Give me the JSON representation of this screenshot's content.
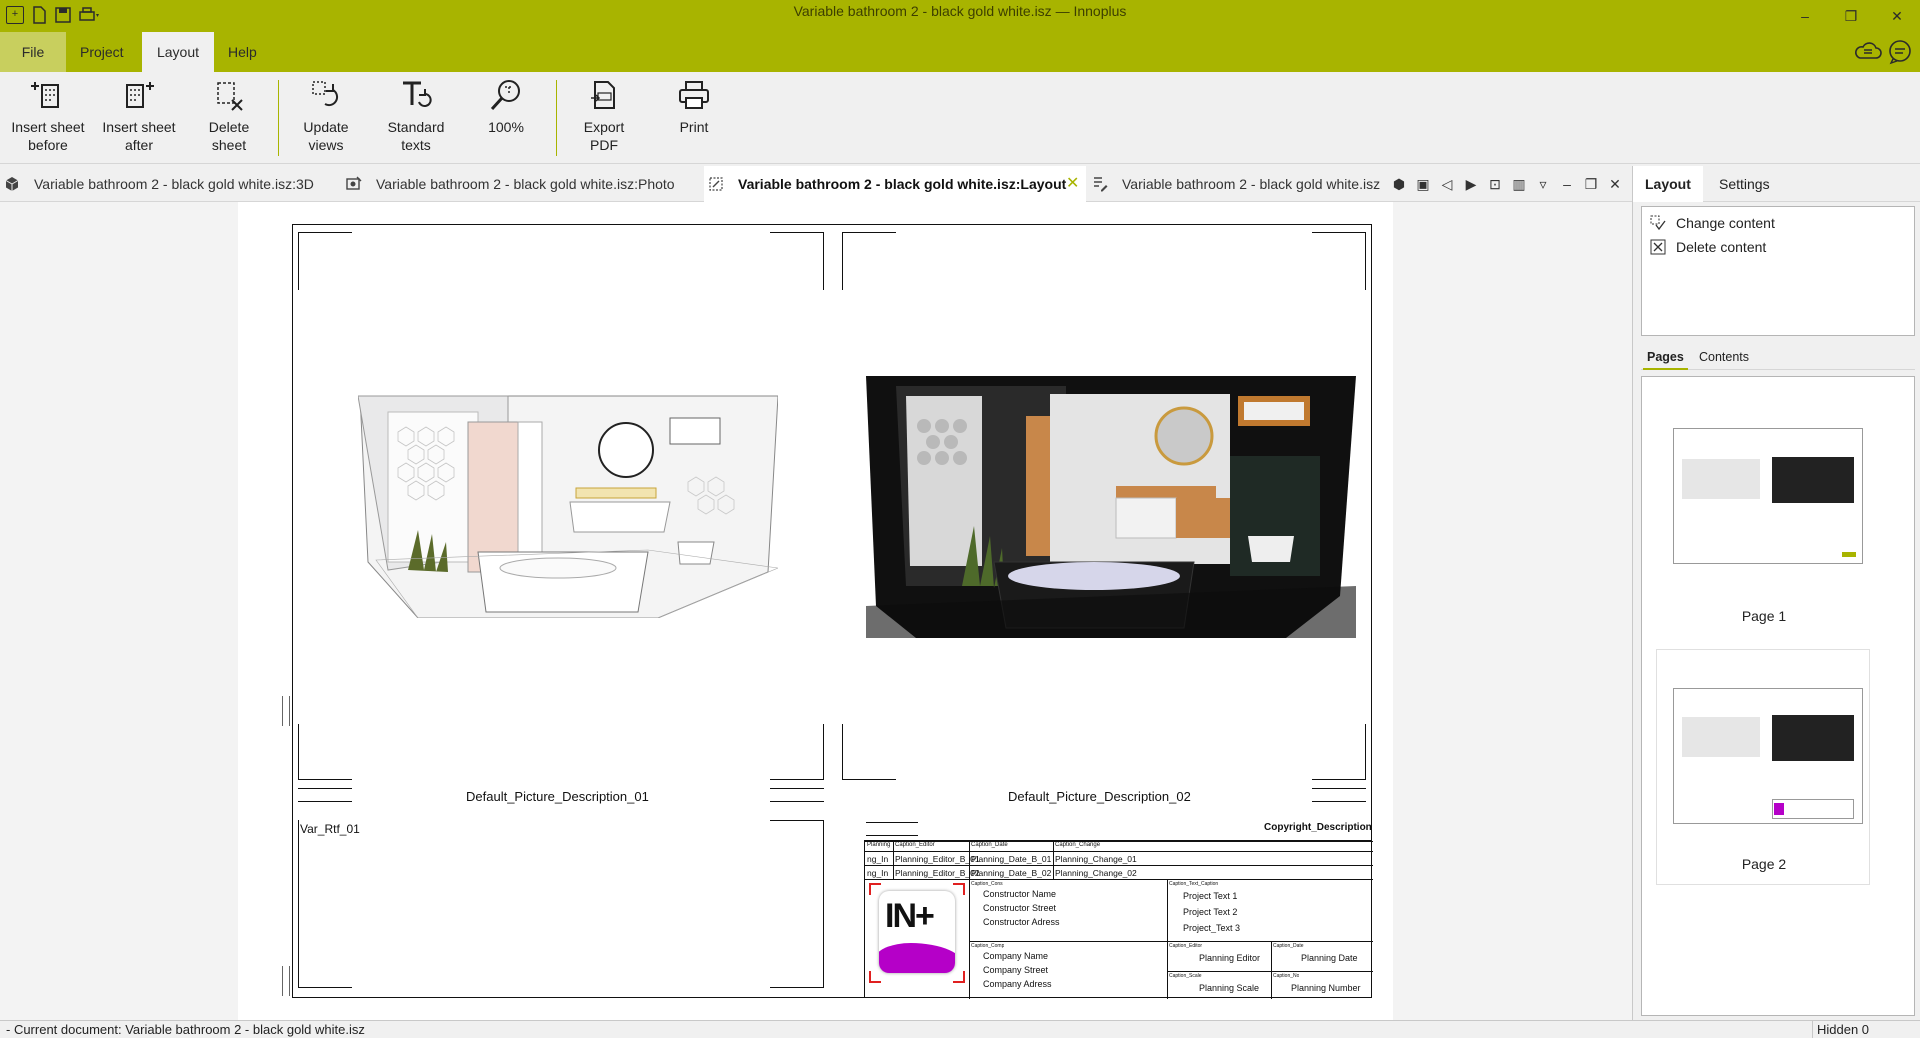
{
  "window": {
    "title": "Variable bathroom 2 - black gold white.isz — Innoplus",
    "minimize": "–",
    "maximize": "❐",
    "close": "✕"
  },
  "menu": {
    "file": "File",
    "project": "Project",
    "layout": "Layout",
    "help": "Help"
  },
  "ribbon": {
    "insert_before": [
      "Insert sheet",
      "before"
    ],
    "insert_after": [
      "Insert sheet",
      "after"
    ],
    "delete_sheet": [
      "Delete",
      "sheet"
    ],
    "update_views": [
      "Update",
      "views"
    ],
    "standard_texts": [
      "Standard",
      "texts"
    ],
    "zoom": "100%",
    "export_pdf": [
      "Export",
      "PDF"
    ],
    "print": "Print"
  },
  "doc_tabs": [
    {
      "label": "Variable bathroom 2 - black gold white.isz:3D",
      "icon": "cube-icon"
    },
    {
      "label": "Variable bathroom 2 - black gold white.isz:Photo",
      "icon": "photo-icon"
    },
    {
      "label": "Variable bathroom 2 - black gold white.isz:Layout",
      "icon": "layout-icon",
      "close": "✕"
    },
    {
      "label": "Variable bathroom 2 - black gold white.isz",
      "icon": "edit-icon"
    }
  ],
  "sheet": {
    "caption_1": "Default_Picture_Description_01",
    "caption_2": "Default_Picture_Description_02",
    "var_ref": "Var_Rtf_01",
    "copyright": "Copyright_Description",
    "title_block": {
      "hdr_1": "Planning",
      "hdr_2": "Caption_Editor",
      "hdr_3": "Caption_Date",
      "hdr_4": "Caption_Change",
      "row1_a": "ng_In",
      "row1_b": "Planning_Editor_B_01",
      "row1_c": "Planning_Date_B_01",
      "row1_d": "Planning_Change_01",
      "row2_a": "ng_In",
      "row2_b": "Planning_Editor_B_02",
      "row2_c": "Planning_Date_B_02",
      "row2_d": "Planning_Change_02",
      "caption_cons": "Caption_Cons",
      "constructor_name": "Constructor  Name",
      "constructor_street": "Constructor  Street",
      "constructor_address": "Constructor  Adress",
      "caption_company": "Caption_Comp",
      "company_name": "Company  Name",
      "company_street": "Company  Street",
      "company_address": "Company  Adress",
      "caption_project_text": "Caption_Text_Caption",
      "project_text_1": "Project  Text  1",
      "project_text_2": "Project  Text  2",
      "project_text_3": "Project_Text  3",
      "caption_editor": "Caption_Editor",
      "planning_editor": "Planning  Editor",
      "caption_date": "Caption_Date",
      "planning_date": "Planning  Date",
      "caption_scale": "Caption_Scale",
      "planning_scale": "Planning  Scale",
      "caption_no": "Caption_No",
      "planning_number": "Planning  Number",
      "logo_text": "IN+"
    }
  },
  "right_panel": {
    "tab_layout": "Layout",
    "tab_settings": "Settings",
    "action_change": "Change content",
    "action_delete": "Delete content",
    "subtab_pages": "Pages",
    "subtab_contents": "Contents",
    "page1": "Page 1",
    "page2": "Page 2"
  },
  "status": {
    "left": "- Current document: Variable bathroom 2 - black gold white.isz",
    "right": "Hidden 0"
  },
  "colors": {
    "accent": "#a8b400",
    "logo_magenta": "#b500c8"
  }
}
